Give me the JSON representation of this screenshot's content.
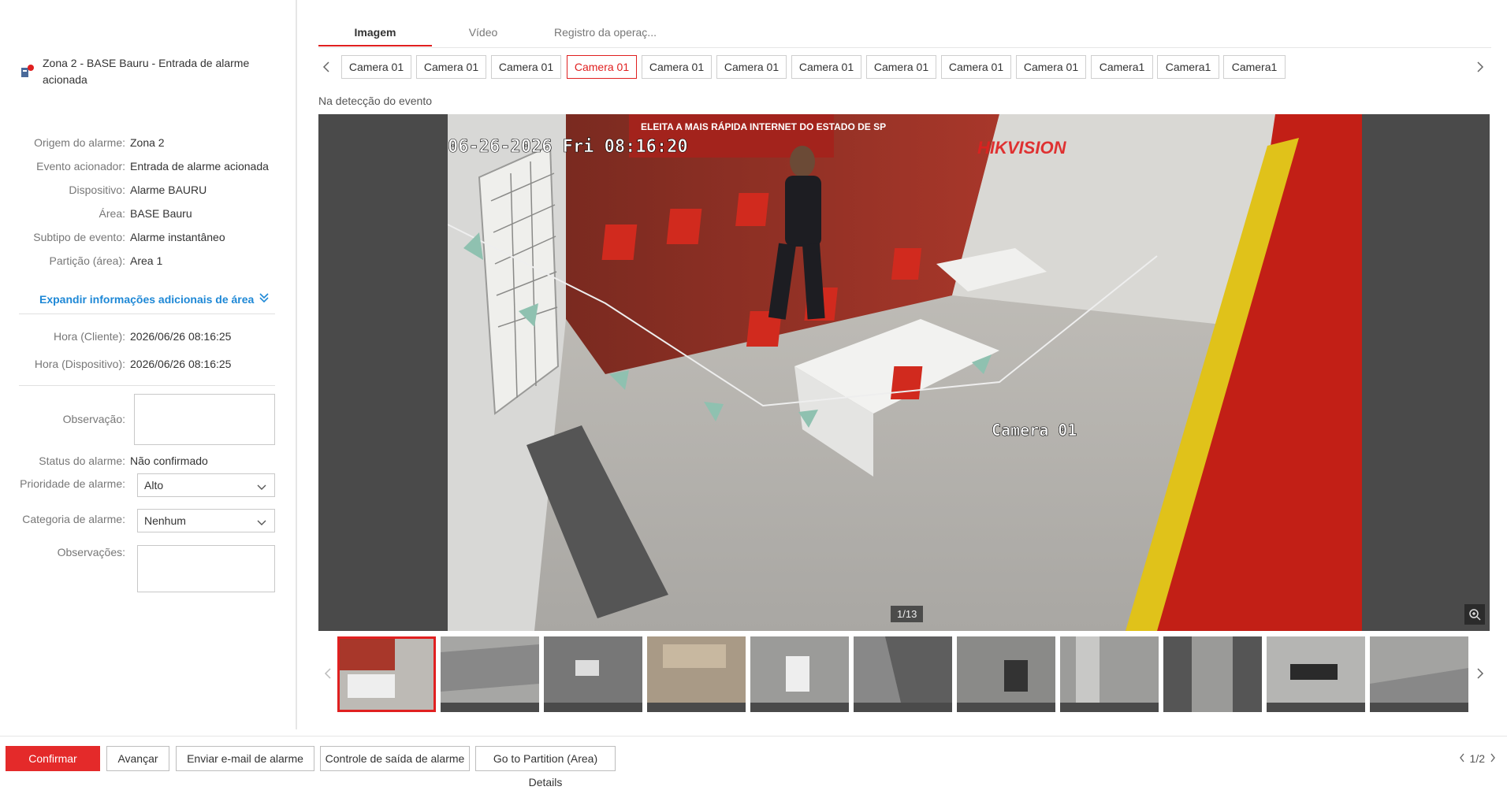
{
  "alarm": {
    "title": "Zona 2 - BASE Bauru - Entrada de alarme acionada"
  },
  "details": [
    {
      "label": "Origem do alarme:",
      "value": "Zona 2"
    },
    {
      "label": "Evento acionador:",
      "value": "Entrada de alarme acionada"
    },
    {
      "label": "Dispositivo:",
      "value": "Alarme BAURU"
    },
    {
      "label": "Área:",
      "value": "BASE Bauru"
    },
    {
      "label": "Subtipo de evento:",
      "value": "Alarme instantâneo"
    },
    {
      "label": "Partição (área):",
      "value": "Area 1"
    }
  ],
  "expand_label": "Expandir informações adicionais de área",
  "times": [
    {
      "label": "Hora (Cliente):",
      "value": "2026/06/26 08:16:25"
    },
    {
      "label": "Hora (Dispositivo):",
      "value": "2026/06/26 08:16:25"
    }
  ],
  "form": {
    "observation_label": "Observação:",
    "observation_value": "",
    "status_label": "Status do alarme:",
    "status_value": "Não confirmado",
    "priority_label": "Prioridade de alarme:",
    "priority_value": "Alto",
    "category_label": "Categoria de alarme:",
    "category_value": "Nenhum",
    "remarks_label": "Observações:",
    "remarks_value": ""
  },
  "tabs": [
    "Imagem",
    "Vídeo",
    "Registro da operaç..."
  ],
  "cameras": [
    "Camera 01",
    "Camera 01",
    "Camera 01",
    "Camera 01",
    "Camera 01",
    "Camera 01",
    "Camera 01",
    "Camera 01",
    "Camera 01",
    "Camera 01",
    "Camera1",
    "Camera1",
    "Camera1"
  ],
  "active_camera_index": 3,
  "detection_label": "Na detecção do evento",
  "overlay": {
    "timestamp": "06-26-2026 Fri 08:16:20",
    "brand": "HIKVISION",
    "camera_label": "Camera 01",
    "sign_text": "ELEITA A MAIS RÁPIDA INTERNET DO ESTADO DE SP"
  },
  "counter": "1/13",
  "footer": {
    "confirm": "Confirmar",
    "next": "Avançar",
    "email": "Enviar e-mail de alarme",
    "output": "Controle de saída de alarme",
    "partition": "Go to Partition (Area) Details",
    "page": "1/2"
  },
  "colors": {
    "accent": "#e02020",
    "link": "#1e88d6",
    "primary_button": "#e42a2a"
  }
}
